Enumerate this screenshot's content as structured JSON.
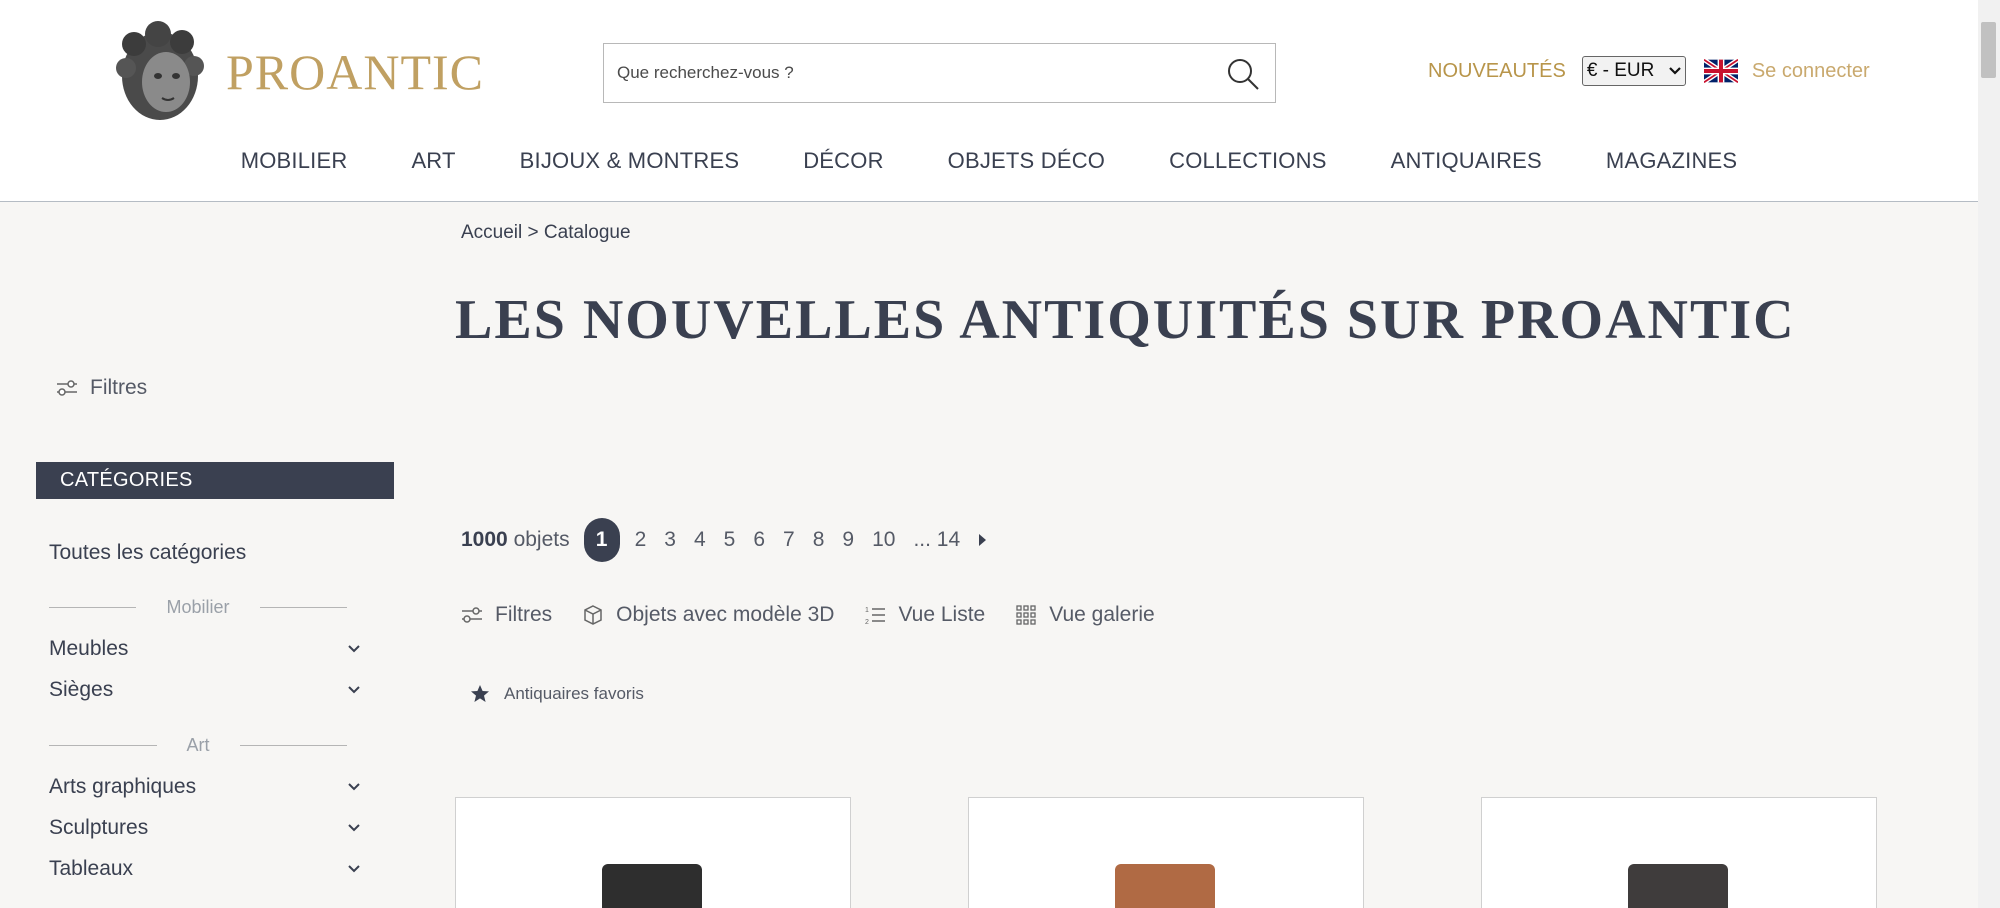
{
  "header": {
    "logo_text": "PROANTIC",
    "search_placeholder": "Que recherchez-vous ?",
    "nouveautes": "NOUVEAUTÉS",
    "currency": "€ - EUR",
    "login": "Se connecter"
  },
  "nav": {
    "items": [
      "MOBILIER",
      "ART",
      "BIJOUX & MONTRES",
      "DÉCOR",
      "OBJETS DÉCO",
      "COLLECTIONS",
      "ANTIQUAIRES",
      "MAGAZINES"
    ]
  },
  "sidebar": {
    "filters_label": "Filtres",
    "categories_header": "CATÉGORIES",
    "all_categories": "Toutes les catégories",
    "groups": [
      {
        "label": "Mobilier",
        "items": [
          "Meubles",
          "Sièges"
        ]
      },
      {
        "label": "Art",
        "items": [
          "Arts graphiques",
          "Sculptures",
          "Tableaux"
        ]
      }
    ]
  },
  "main": {
    "breadcrumb": "Accueil > Catalogue",
    "title": "LES NOUVELLES ANTIQUITÉS SUR PROANTIC",
    "count_number": "1000",
    "count_label": "objets",
    "pages": [
      "1",
      "2",
      "3",
      "4",
      "5",
      "6",
      "7",
      "8",
      "9",
      "10",
      "... 14"
    ],
    "active_page": "1",
    "toolbar": {
      "filters": "Filtres",
      "objects_3d": "Objets avec modèle 3D",
      "list_view": "Vue Liste",
      "gallery_view": "Vue galerie"
    },
    "favorite_dealers": "Antiquaires favoris"
  },
  "colors": {
    "brand_gold": "#c0a062",
    "dark_navy": "#3a4050",
    "background": "#f7f6f4"
  }
}
